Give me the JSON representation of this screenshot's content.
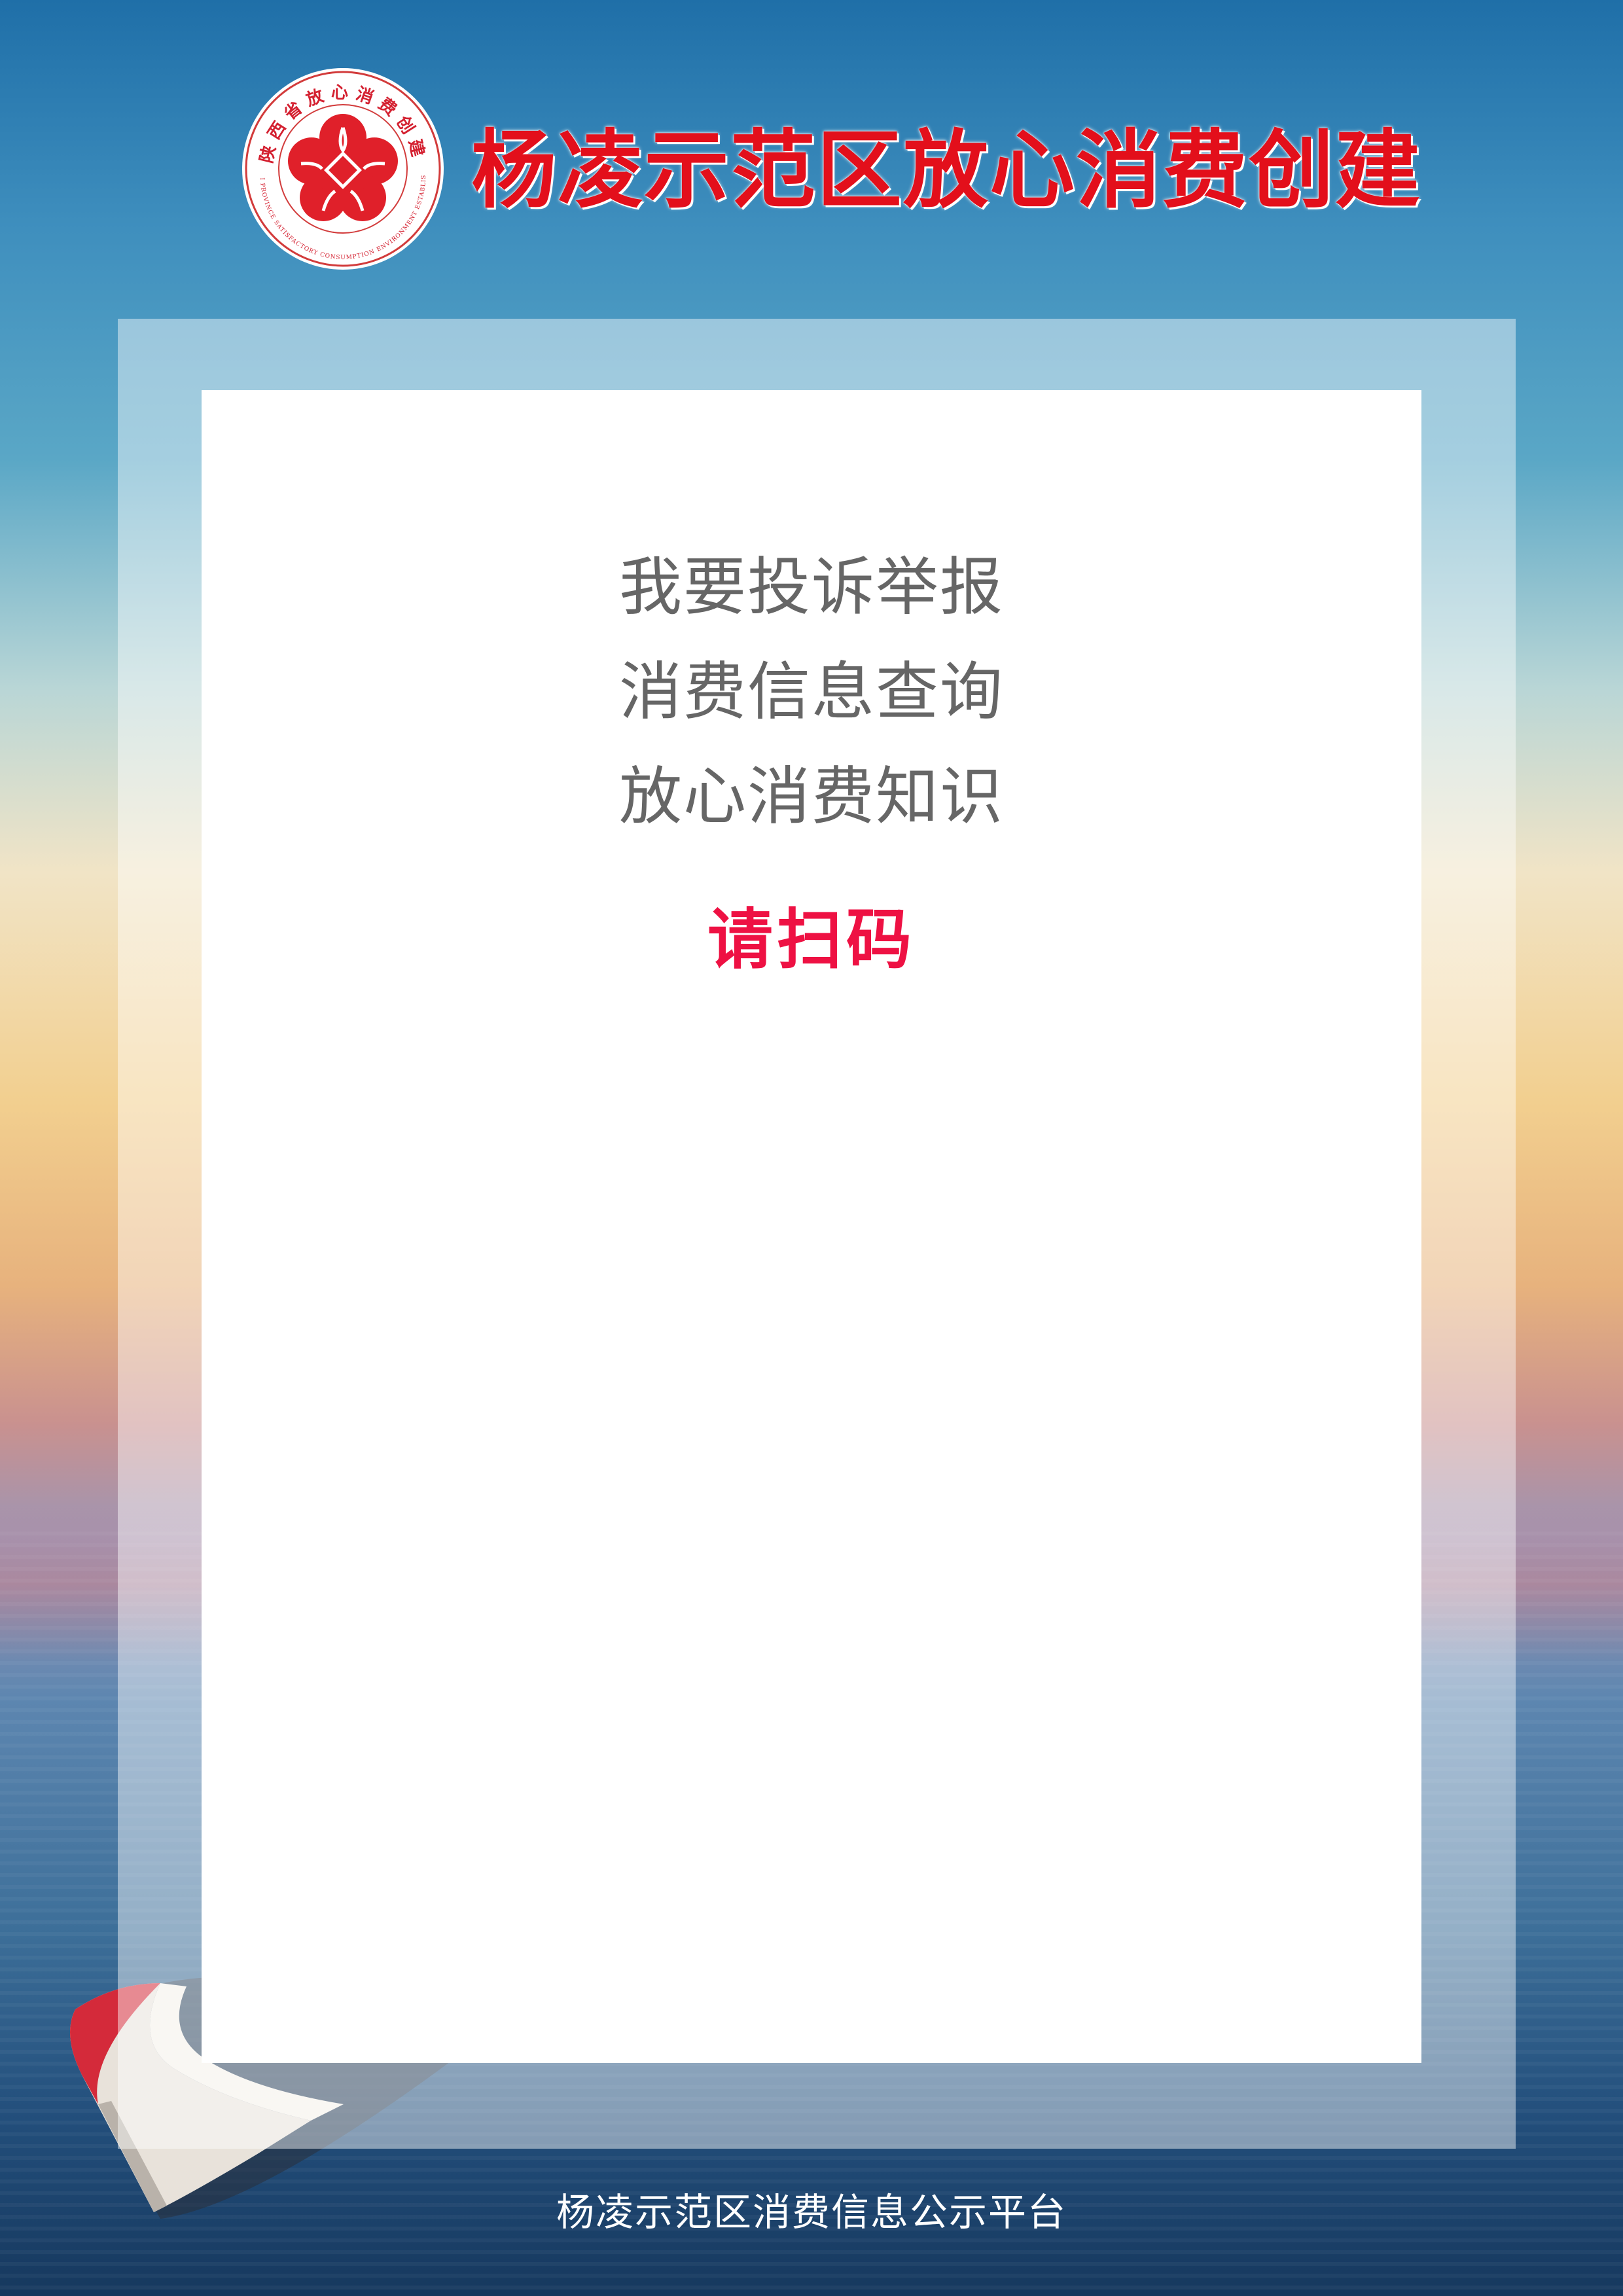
{
  "header": {
    "logo_ring_text": "陕西省放心消费创建",
    "logo_english_text": "SHAANXI PROVINCE SATISFACTORY CONSUMPTION ENVIRONMENT ESTABLISHMENT",
    "title": "杨凌示范区放心消费创建"
  },
  "panel": {
    "menu": [
      {
        "label": "我要投诉举报"
      },
      {
        "label": "消费信息查询"
      },
      {
        "label": "放心消费知识"
      }
    ],
    "call_to_action": "请扫码"
  },
  "footer": {
    "text": "杨凌示范区消费信息公示平台"
  },
  "colors": {
    "title_red": "#e30f1b",
    "cta_red": "#ee1143",
    "menu_gray": "#666666",
    "logo_red": "#e0202a"
  },
  "icons": {
    "logo": "flower-heart-emblem"
  }
}
